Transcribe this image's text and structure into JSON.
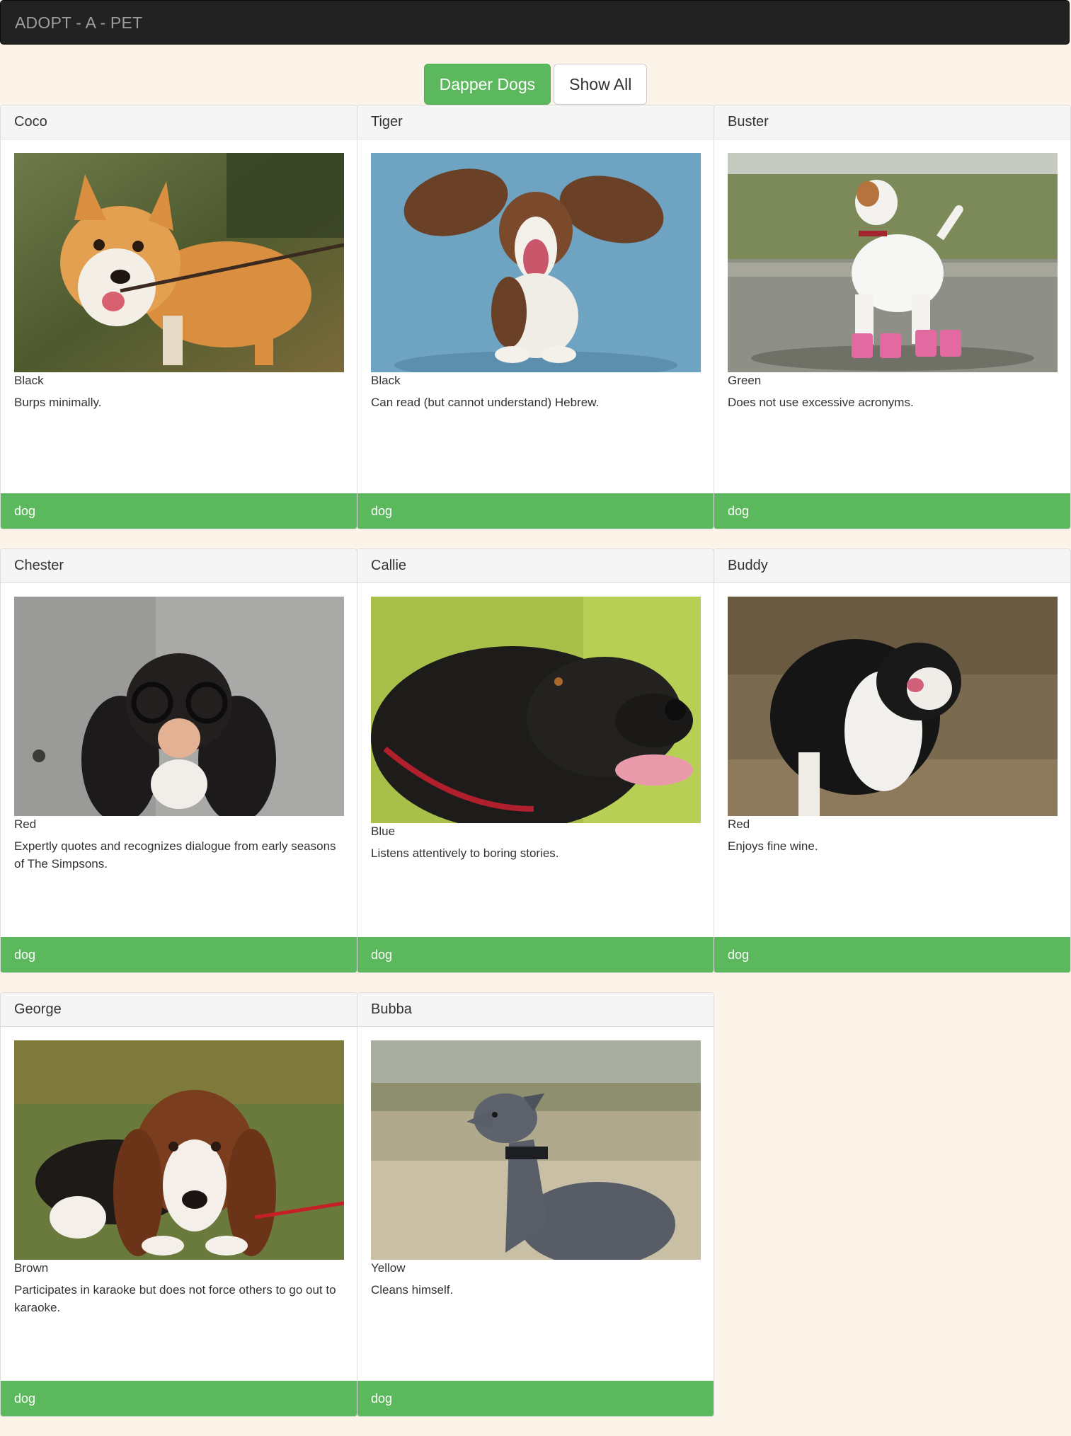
{
  "navbar": {
    "brand": "ADOPT - A - PET"
  },
  "filters": {
    "active_label": "Dapper Dogs",
    "show_all_label": "Show All"
  },
  "pets": [
    {
      "name": "Coco",
      "color": "Black",
      "description": "Burps minimally.",
      "type": "dog"
    },
    {
      "name": "Tiger",
      "color": "Black",
      "description": "Can read (but cannot understand) Hebrew.",
      "type": "dog"
    },
    {
      "name": "Buster",
      "color": "Green",
      "description": "Does not use excessive acronyms.",
      "type": "dog"
    },
    {
      "name": "Chester",
      "color": "Red",
      "description": "Expertly quotes and recognizes dialogue from early seasons of The Simpsons.",
      "type": "dog"
    },
    {
      "name": "Callie",
      "color": "Blue",
      "description": "Listens attentively to boring stories.",
      "type": "dog"
    },
    {
      "name": "Buddy",
      "color": "Red",
      "description": "Enjoys fine wine.",
      "type": "dog"
    },
    {
      "name": "George",
      "color": "Brown",
      "description": "Participates in karaoke but does not force others to go out to karaoke.",
      "type": "dog"
    },
    {
      "name": "Bubba",
      "color": "Yellow",
      "description": "Cleans himself.",
      "type": "dog"
    }
  ],
  "colors": {
    "accent": "#5cb85c",
    "navbar": "#222222",
    "page_background": "#fcf4e9"
  }
}
